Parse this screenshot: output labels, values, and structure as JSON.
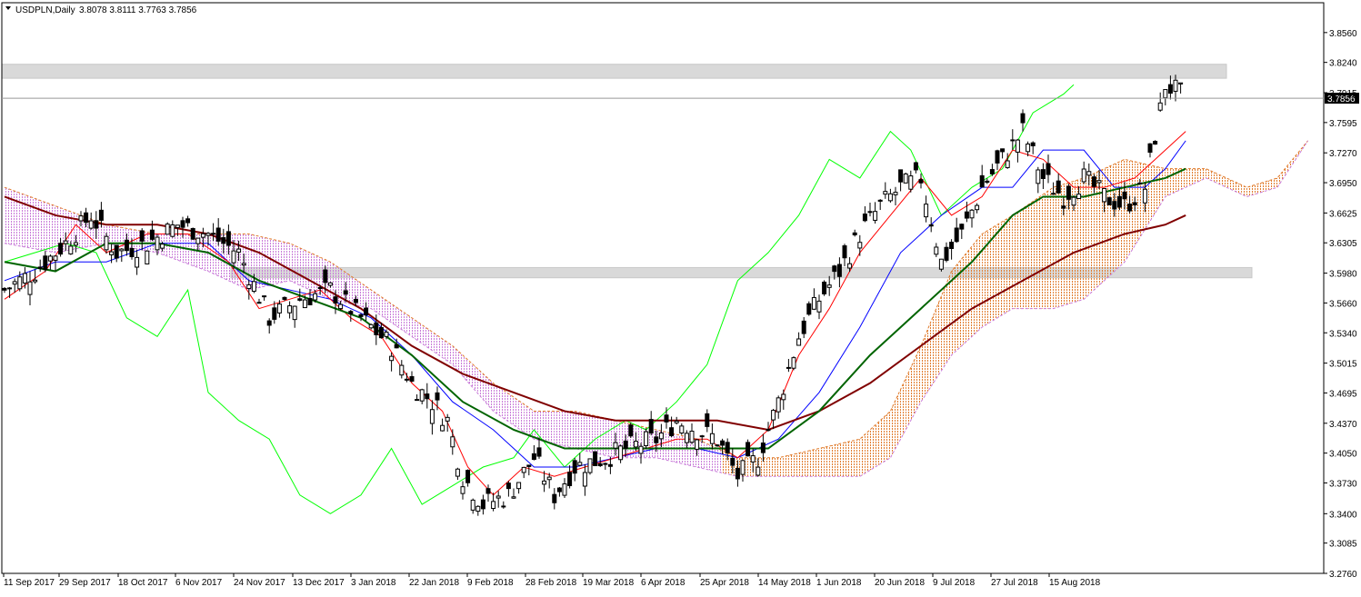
{
  "header": {
    "symbol_label": "USDPLN,Daily",
    "ohlc": "3.8078 3.8111 3.7763 3.7856",
    "dropdown_icon": "triangle-down-icon"
  },
  "price_label": "3.7856",
  "colors": {
    "background": "#ffffff",
    "bull_candle": "#ffffff",
    "bear_candle": "#000000",
    "tenkan": "#ff0000",
    "kijun": "#0000ff",
    "chikou": "#00ff00",
    "ma_fast": "#006400",
    "ma_slow": "#800000",
    "cloud_bull": "#e07a2a",
    "cloud_bear": "#c87ad8",
    "zone_fill": "#d9d9d9",
    "price_line": "#999999"
  },
  "chart_data": {
    "type": "candlestick",
    "symbol": "USDPLN",
    "timeframe": "Daily",
    "ylim": [
      3.276,
      3.888
    ],
    "y_ticks": [
      "3.8560",
      "3.8240",
      "3.7915",
      "3.7595",
      "3.7270",
      "3.6950",
      "3.6625",
      "3.6305",
      "3.5980",
      "3.5660",
      "3.5340",
      "3.5015",
      "3.4695",
      "3.4370",
      "3.4050",
      "3.3730",
      "3.3400",
      "3.3085",
      "3.2760"
    ],
    "x_ticks": [
      "11 Sep 2017",
      "29 Sep 2017",
      "18 Oct 2017",
      "6 Nov 2017",
      "24 Nov 2017",
      "13 Dec 2017",
      "3 Jan 2018",
      "22 Jan 2018",
      "9 Feb 2018",
      "28 Feb 2018",
      "19 Mar 2018",
      "6 Apr 2018",
      "25 Apr 2018",
      "14 May 2018",
      "1 Jun 2018",
      "20 Jun 2018",
      "9 Jul 2018",
      "27 Jul 2018",
      "15 Aug 2018"
    ],
    "last_price": 3.7856,
    "price_track": [
      [
        0,
        3.58
      ],
      [
        6,
        3.6
      ],
      [
        12,
        3.63
      ],
      [
        17,
        3.66
      ],
      [
        22,
        3.62
      ],
      [
        28,
        3.63
      ],
      [
        34,
        3.65
      ],
      [
        40,
        3.64
      ],
      [
        46,
        3.62
      ],
      [
        52,
        3.55
      ],
      [
        58,
        3.57
      ],
      [
        64,
        3.58
      ],
      [
        70,
        3.55
      ],
      [
        76,
        3.52
      ],
      [
        80,
        3.48
      ],
      [
        84,
        3.46
      ],
      [
        87,
        3.44
      ],
      [
        90,
        3.38
      ],
      [
        94,
        3.35
      ],
      [
        99,
        3.36
      ],
      [
        104,
        3.4
      ],
      [
        108,
        3.36
      ],
      [
        112,
        3.39
      ],
      [
        118,
        3.4
      ],
      [
        122,
        3.41
      ],
      [
        128,
        3.42
      ],
      [
        132,
        3.44
      ],
      [
        136,
        3.43
      ],
      [
        140,
        3.42
      ],
      [
        144,
        3.38
      ],
      [
        148,
        3.4
      ],
      [
        152,
        3.46
      ],
      [
        156,
        3.53
      ],
      [
        160,
        3.57
      ],
      [
        164,
        3.6
      ],
      [
        168,
        3.64
      ],
      [
        172,
        3.67
      ],
      [
        176,
        3.69
      ],
      [
        180,
        3.7
      ],
      [
        184,
        3.61
      ],
      [
        188,
        3.64
      ],
      [
        192,
        3.69
      ],
      [
        196,
        3.72
      ],
      [
        200,
        3.75
      ],
      [
        204,
        3.7
      ],
      [
        208,
        3.68
      ],
      [
        212,
        3.7
      ],
      [
        216,
        3.68
      ],
      [
        220,
        3.67
      ],
      [
        224,
        3.69
      ],
      [
        228,
        3.8
      ],
      [
        231,
        3.79
      ]
    ],
    "tenkan": [
      [
        0,
        3.57
      ],
      [
        8,
        3.6
      ],
      [
        14,
        3.65
      ],
      [
        20,
        3.62
      ],
      [
        28,
        3.64
      ],
      [
        36,
        3.64
      ],
      [
        44,
        3.61
      ],
      [
        50,
        3.56
      ],
      [
        56,
        3.57
      ],
      [
        62,
        3.58
      ],
      [
        68,
        3.55
      ],
      [
        74,
        3.53
      ],
      [
        80,
        3.48
      ],
      [
        86,
        3.45
      ],
      [
        91,
        3.39
      ],
      [
        96,
        3.36
      ],
      [
        102,
        3.39
      ],
      [
        108,
        3.38
      ],
      [
        114,
        3.39
      ],
      [
        120,
        3.4
      ],
      [
        126,
        3.41
      ],
      [
        132,
        3.42
      ],
      [
        138,
        3.42
      ],
      [
        144,
        3.4
      ],
      [
        150,
        3.43
      ],
      [
        156,
        3.51
      ],
      [
        162,
        3.56
      ],
      [
        168,
        3.62
      ],
      [
        174,
        3.66
      ],
      [
        180,
        3.7
      ],
      [
        186,
        3.66
      ],
      [
        192,
        3.68
      ],
      [
        198,
        3.73
      ],
      [
        204,
        3.72
      ],
      [
        210,
        3.69
      ],
      [
        216,
        3.69
      ],
      [
        222,
        3.7
      ],
      [
        228,
        3.73
      ],
      [
        232,
        3.75
      ]
    ],
    "kijun": [
      [
        0,
        3.59
      ],
      [
        10,
        3.61
      ],
      [
        20,
        3.61
      ],
      [
        30,
        3.63
      ],
      [
        40,
        3.63
      ],
      [
        48,
        3.59
      ],
      [
        56,
        3.58
      ],
      [
        64,
        3.57
      ],
      [
        72,
        3.55
      ],
      [
        80,
        3.51
      ],
      [
        88,
        3.46
      ],
      [
        96,
        3.43
      ],
      [
        104,
        3.39
      ],
      [
        112,
        3.39
      ],
      [
        120,
        3.4
      ],
      [
        128,
        3.41
      ],
      [
        136,
        3.41
      ],
      [
        144,
        3.4
      ],
      [
        152,
        3.42
      ],
      [
        160,
        3.47
      ],
      [
        168,
        3.54
      ],
      [
        176,
        3.62
      ],
      [
        184,
        3.66
      ],
      [
        192,
        3.69
      ],
      [
        198,
        3.69
      ],
      [
        204,
        3.73
      ],
      [
        212,
        3.73
      ],
      [
        218,
        3.69
      ],
      [
        224,
        3.69
      ],
      [
        228,
        3.71
      ],
      [
        232,
        3.74
      ]
    ],
    "chikou": [
      [
        0,
        3.61
      ],
      [
        6,
        3.62
      ],
      [
        12,
        3.63
      ],
      [
        18,
        3.62
      ],
      [
        24,
        3.55
      ],
      [
        30,
        3.53
      ],
      [
        36,
        3.58
      ],
      [
        40,
        3.47
      ],
      [
        46,
        3.44
      ],
      [
        52,
        3.42
      ],
      [
        58,
        3.36
      ],
      [
        64,
        3.34
      ],
      [
        70,
        3.36
      ],
      [
        76,
        3.41
      ],
      [
        82,
        3.35
      ],
      [
        88,
        3.37
      ],
      [
        94,
        3.39
      ],
      [
        100,
        3.4
      ],
      [
        104,
        3.43
      ],
      [
        110,
        3.39
      ],
      [
        116,
        3.42
      ],
      [
        122,
        3.44
      ],
      [
        126,
        3.43
      ],
      [
        132,
        3.46
      ],
      [
        138,
        3.5
      ],
      [
        144,
        3.59
      ],
      [
        150,
        3.62
      ],
      [
        156,
        3.66
      ],
      [
        162,
        3.72
      ],
      [
        168,
        3.7
      ],
      [
        174,
        3.75
      ],
      [
        178,
        3.73
      ],
      [
        184,
        3.66
      ],
      [
        190,
        3.69
      ],
      [
        196,
        3.71
      ],
      [
        202,
        3.77
      ],
      [
        208,
        3.79
      ],
      [
        210,
        3.8
      ]
    ],
    "ma_fast": [
      [
        0,
        3.61
      ],
      [
        10,
        3.6
      ],
      [
        20,
        3.63
      ],
      [
        30,
        3.63
      ],
      [
        40,
        3.62
      ],
      [
        50,
        3.59
      ],
      [
        60,
        3.57
      ],
      [
        70,
        3.55
      ],
      [
        80,
        3.51
      ],
      [
        90,
        3.46
      ],
      [
        100,
        3.43
      ],
      [
        110,
        3.41
      ],
      [
        120,
        3.41
      ],
      [
        130,
        3.41
      ],
      [
        140,
        3.41
      ],
      [
        150,
        3.41
      ],
      [
        160,
        3.45
      ],
      [
        170,
        3.51
      ],
      [
        180,
        3.56
      ],
      [
        190,
        3.61
      ],
      [
        198,
        3.66
      ],
      [
        204,
        3.68
      ],
      [
        212,
        3.68
      ],
      [
        220,
        3.69
      ],
      [
        228,
        3.7
      ],
      [
        232,
        3.71
      ]
    ],
    "ma_slow": [
      [
        0,
        3.68
      ],
      [
        10,
        3.66
      ],
      [
        20,
        3.65
      ],
      [
        30,
        3.65
      ],
      [
        40,
        3.64
      ],
      [
        50,
        3.62
      ],
      [
        60,
        3.59
      ],
      [
        70,
        3.56
      ],
      [
        80,
        3.52
      ],
      [
        90,
        3.49
      ],
      [
        100,
        3.47
      ],
      [
        110,
        3.45
      ],
      [
        120,
        3.44
      ],
      [
        130,
        3.44
      ],
      [
        140,
        3.44
      ],
      [
        150,
        3.43
      ],
      [
        160,
        3.45
      ],
      [
        170,
        3.48
      ],
      [
        180,
        3.52
      ],
      [
        190,
        3.56
      ],
      [
        200,
        3.59
      ],
      [
        210,
        3.62
      ],
      [
        220,
        3.64
      ],
      [
        228,
        3.65
      ],
      [
        232,
        3.66
      ]
    ],
    "cloud_upper": [
      [
        0,
        3.69
      ],
      [
        10,
        3.67
      ],
      [
        20,
        3.65
      ],
      [
        30,
        3.64
      ],
      [
        40,
        3.64
      ],
      [
        48,
        3.64
      ],
      [
        56,
        3.63
      ],
      [
        64,
        3.61
      ],
      [
        72,
        3.58
      ],
      [
        80,
        3.55
      ],
      [
        88,
        3.52
      ],
      [
        96,
        3.48
      ],
      [
        104,
        3.45
      ],
      [
        112,
        3.45
      ],
      [
        120,
        3.44
      ],
      [
        128,
        3.43
      ],
      [
        136,
        3.42
      ],
      [
        144,
        3.4
      ],
      [
        152,
        3.4
      ],
      [
        160,
        3.41
      ],
      [
        168,
        3.42
      ],
      [
        174,
        3.45
      ],
      [
        180,
        3.52
      ],
      [
        186,
        3.6
      ],
      [
        192,
        3.64
      ],
      [
        198,
        3.66
      ],
      [
        206,
        3.69
      ],
      [
        212,
        3.7
      ],
      [
        220,
        3.72
      ],
      [
        228,
        3.71
      ],
      [
        236,
        3.71
      ],
      [
        244,
        3.69
      ],
      [
        250,
        3.7
      ],
      [
        256,
        3.74
      ]
    ],
    "cloud_lower": [
      [
        0,
        3.63
      ],
      [
        10,
        3.62
      ],
      [
        20,
        3.63
      ],
      [
        30,
        3.62
      ],
      [
        40,
        3.6
      ],
      [
        48,
        3.58
      ],
      [
        56,
        3.59
      ],
      [
        64,
        3.57
      ],
      [
        72,
        3.56
      ],
      [
        80,
        3.53
      ],
      [
        88,
        3.5
      ],
      [
        96,
        3.45
      ],
      [
        104,
        3.42
      ],
      [
        112,
        3.41
      ],
      [
        120,
        3.4
      ],
      [
        128,
        3.4
      ],
      [
        136,
        3.39
      ],
      [
        144,
        3.38
      ],
      [
        152,
        3.38
      ],
      [
        160,
        3.38
      ],
      [
        168,
        3.38
      ],
      [
        174,
        3.4
      ],
      [
        180,
        3.46
      ],
      [
        186,
        3.51
      ],
      [
        192,
        3.54
      ],
      [
        198,
        3.56
      ],
      [
        206,
        3.56
      ],
      [
        212,
        3.57
      ],
      [
        220,
        3.61
      ],
      [
        228,
        3.68
      ],
      [
        236,
        3.7
      ],
      [
        244,
        3.68
      ],
      [
        250,
        3.69
      ],
      [
        256,
        3.74
      ]
    ],
    "zones": [
      {
        "from": 3.807,
        "to": 3.822,
        "x_start_bar": 0,
        "x_end_bar": 240
      },
      {
        "from": 3.593,
        "to": 3.604,
        "x_start_bar": 45,
        "x_end_bar": 245
      }
    ],
    "bar_count": 258,
    "grid": false
  }
}
